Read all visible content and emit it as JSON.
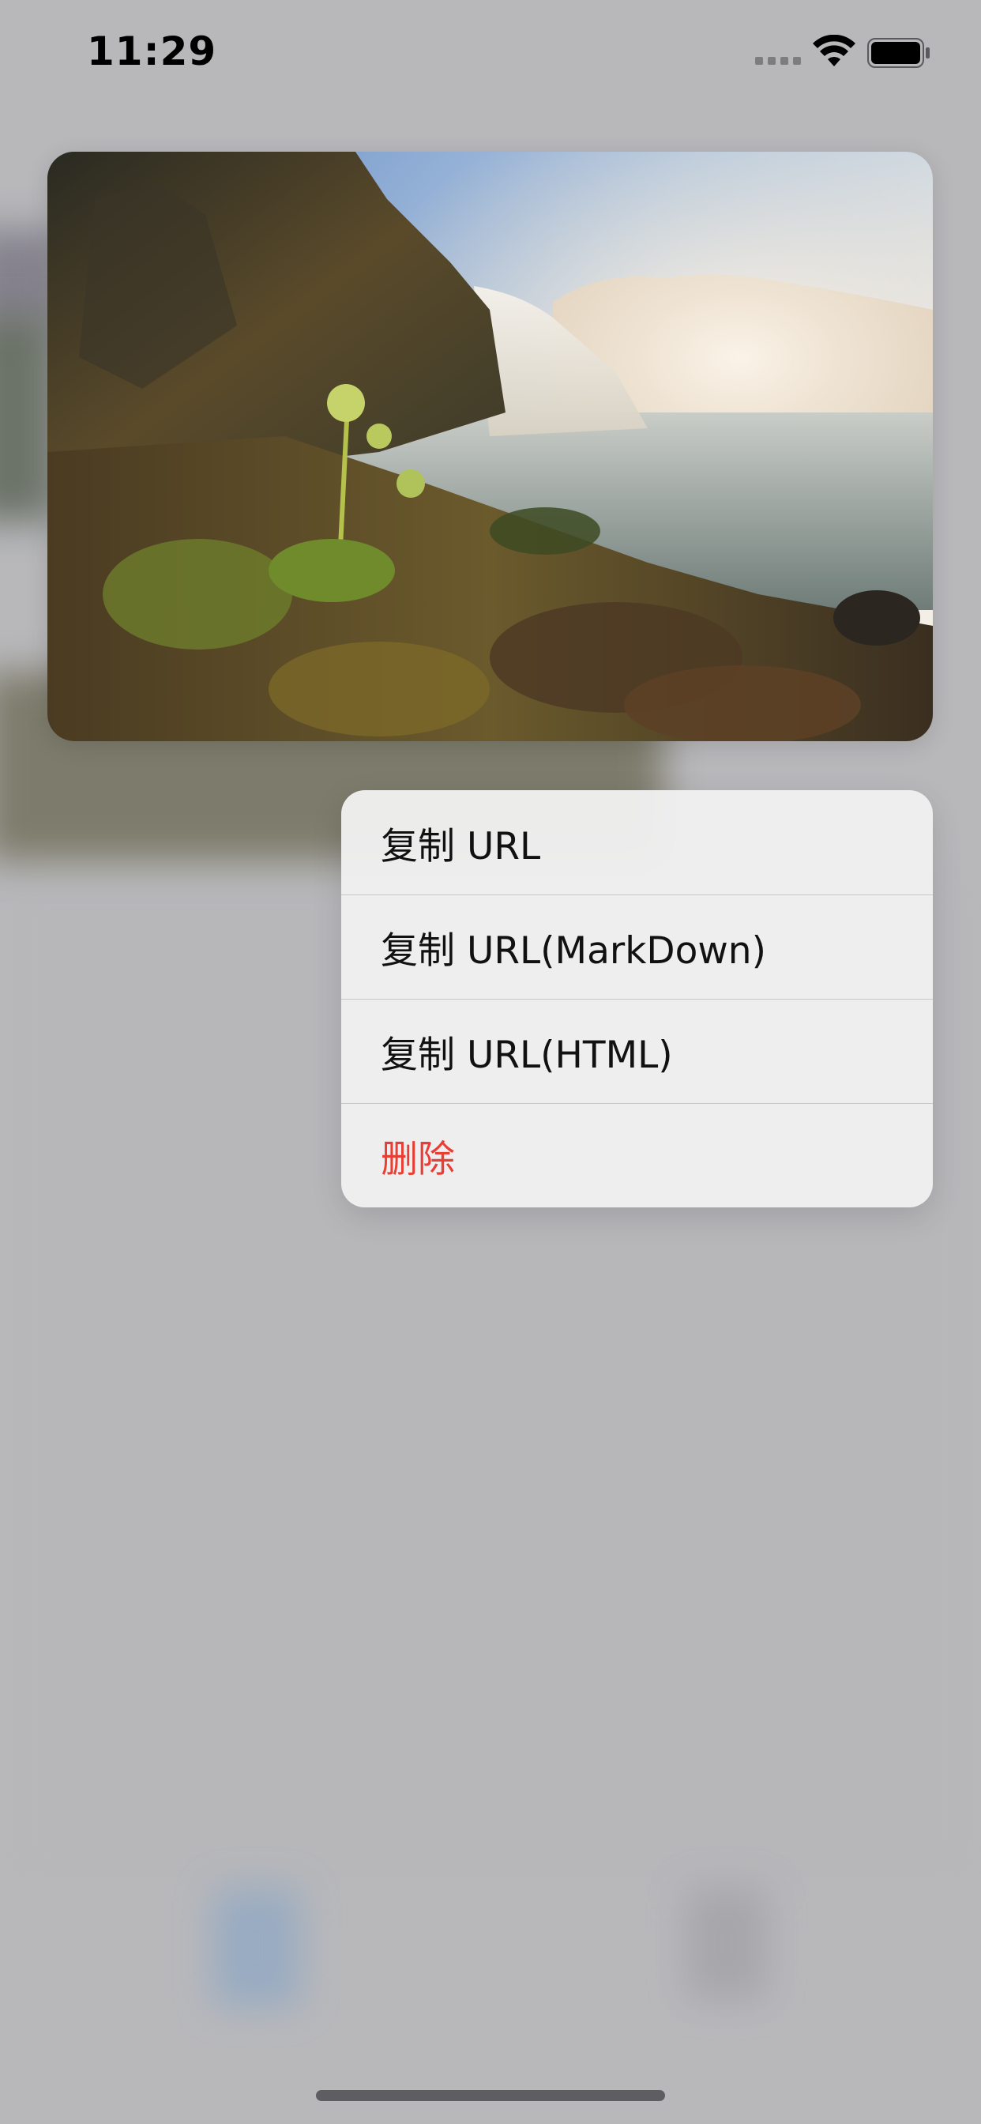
{
  "status_bar": {
    "time": "11:29",
    "icons": [
      "signal-icon",
      "wifi-icon",
      "battery-icon"
    ]
  },
  "preview": {
    "icon": "waterfall-photo"
  },
  "context_menu": {
    "items": [
      {
        "label": "复制 URL"
      },
      {
        "label": "复制 URL(MarkDown)"
      },
      {
        "label": "复制 URL(HTML)"
      },
      {
        "label": "删除",
        "destructive": true
      }
    ]
  },
  "colors": {
    "destructive": "#ea3d33",
    "menu_background": "#efeff0",
    "backdrop": "#b8b8bb"
  }
}
